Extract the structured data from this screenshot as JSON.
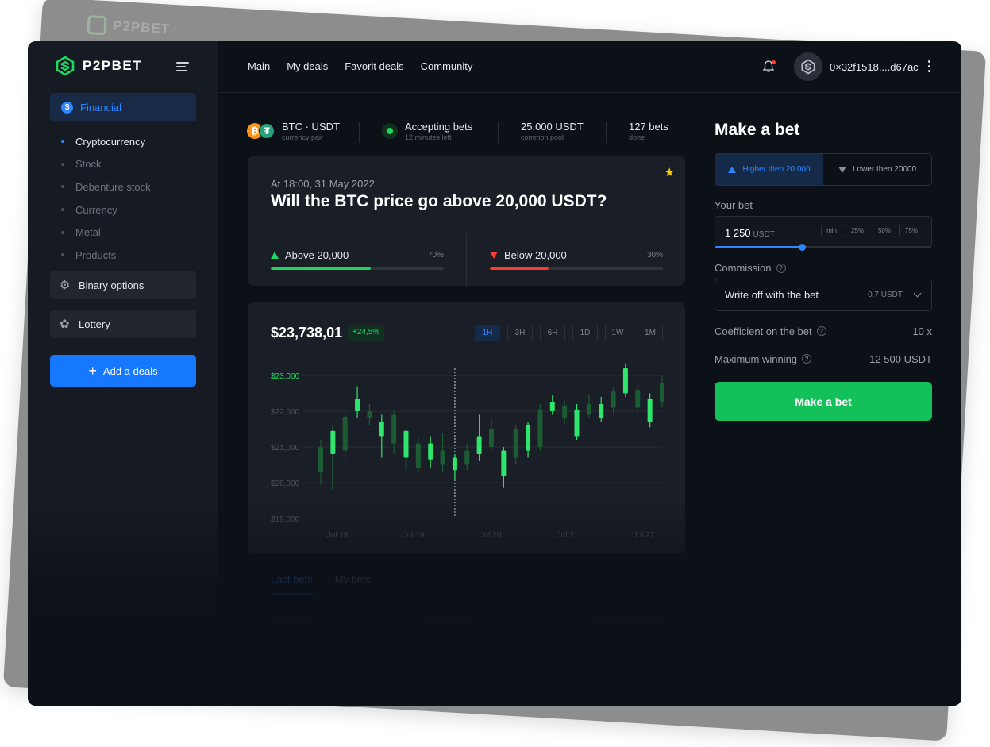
{
  "brand": {
    "name": "P2PBET",
    "accent": "#2f86ff",
    "green": "#1ed760",
    "red": "#ff3b30"
  },
  "sidebar": {
    "financial_label": "Financial",
    "sub_items": [
      "Cryptocurrency",
      "Stock",
      "Debenture stock",
      "Currency",
      "Metal",
      "Products"
    ],
    "active_sub": "Cryptocurrency",
    "binary_label": "Binary options",
    "lottery_label": "Lottery",
    "add_label": "Add a deals"
  },
  "header": {
    "nav": [
      "Main",
      "My deals",
      "Favorit deals",
      "Community"
    ],
    "wallet": "0×32f1518....d67ac"
  },
  "info": {
    "pair": "BTC · USDT",
    "pair_sub": "currency pair",
    "status": "Accepting bets",
    "status_sub": "12 minutes left",
    "pool": "25.000 USDT",
    "pool_sub": "common pool",
    "bets": "127 bets",
    "bets_sub": "done"
  },
  "question": {
    "date": "At 18:00, 31 May 2022",
    "title": "Will the BTC price go above 20,000 USDT?",
    "above_label": "Above 20,000",
    "above_pct": "70%",
    "above_value": 0.58,
    "below_label": "Below 20,000",
    "below_pct": "30%",
    "below_value": 0.34
  },
  "chart": {
    "price": "$23,738,01",
    "change": "+24,5%",
    "timeframes": [
      "1H",
      "3H",
      "6H",
      "1D",
      "1W",
      "1M"
    ],
    "active_timeframe": "1H"
  },
  "chart_data": {
    "type": "candlestick",
    "y_ticks": [
      "$23,000",
      "$22,000",
      "$21,000",
      "$20,000",
      "$19,000"
    ],
    "x_ticks": [
      "Jul 18",
      "Jul 19",
      "Jul 20",
      "Jul 21",
      "Jul 22"
    ],
    "ylim": [
      19000,
      23300
    ],
    "highlight_tick": "$23,000",
    "candles": [
      {
        "o": 20300,
        "c": 21000,
        "h": 21200,
        "l": 19950,
        "bright": false
      },
      {
        "o": 20800,
        "c": 21450,
        "h": 21600,
        "l": 19800,
        "bright": true
      },
      {
        "o": 20900,
        "c": 21850,
        "h": 22050,
        "l": 20600,
        "bright": false
      },
      {
        "o": 22000,
        "c": 22350,
        "h": 22700,
        "l": 21800,
        "bright": true
      },
      {
        "o": 22000,
        "c": 21800,
        "h": 22200,
        "l": 21600,
        "bright": false
      },
      {
        "o": 21700,
        "c": 21300,
        "h": 21900,
        "l": 20700,
        "bright": true
      },
      {
        "o": 21100,
        "c": 21900,
        "h": 22000,
        "l": 20800,
        "bright": false
      },
      {
        "o": 21450,
        "c": 20700,
        "h": 21500,
        "l": 20350,
        "bright": true
      },
      {
        "o": 21100,
        "c": 20400,
        "h": 21300,
        "l": 20300,
        "bright": false
      },
      {
        "o": 21100,
        "c": 20650,
        "h": 21300,
        "l": 20400,
        "bright": true
      },
      {
        "o": 20900,
        "c": 20500,
        "h": 21400,
        "l": 20300,
        "bright": false
      },
      {
        "o": 20350,
        "c": 20700,
        "h": 20800,
        "l": 20100,
        "bright": true
      },
      {
        "o": 20500,
        "c": 20900,
        "h": 21100,
        "l": 20350,
        "bright": false
      },
      {
        "o": 20800,
        "c": 21300,
        "h": 21900,
        "l": 20600,
        "bright": true
      },
      {
        "o": 21000,
        "c": 21500,
        "h": 21800,
        "l": 20900,
        "bright": false
      },
      {
        "o": 20200,
        "c": 20900,
        "h": 21000,
        "l": 19850,
        "bright": true
      },
      {
        "o": 20700,
        "c": 21500,
        "h": 21600,
        "l": 20500,
        "bright": false
      },
      {
        "o": 20900,
        "c": 21600,
        "h": 21700,
        "l": 20700,
        "bright": true
      },
      {
        "o": 21000,
        "c": 22050,
        "h": 22200,
        "l": 20900,
        "bright": false
      },
      {
        "o": 22250,
        "c": 22000,
        "h": 22450,
        "l": 21900,
        "bright": true
      },
      {
        "o": 22150,
        "c": 21800,
        "h": 22300,
        "l": 21650,
        "bright": false
      },
      {
        "o": 21300,
        "c": 22050,
        "h": 22200,
        "l": 21200,
        "bright": true
      },
      {
        "o": 21900,
        "c": 22200,
        "h": 22450,
        "l": 21800,
        "bright": false
      },
      {
        "o": 21800,
        "c": 22200,
        "h": 22400,
        "l": 21700,
        "bright": true
      },
      {
        "o": 22100,
        "c": 22550,
        "h": 22650,
        "l": 21900,
        "bright": false
      },
      {
        "o": 22500,
        "c": 23200,
        "h": 23350,
        "l": 22400,
        "bright": true
      },
      {
        "o": 22100,
        "c": 22600,
        "h": 22850,
        "l": 21950,
        "bright": false
      },
      {
        "o": 21700,
        "c": 22350,
        "h": 22500,
        "l": 21550,
        "bright": true
      },
      {
        "o": 22250,
        "c": 22800,
        "h": 23000,
        "l": 22100,
        "bright": false
      }
    ],
    "marker_candle": 11
  },
  "tabs": {
    "last_bets": "Last bets",
    "my_bets": "My bets",
    "active": "Last bets"
  },
  "columns": [
    "Account",
    "Ammount",
    "Date and time"
  ],
  "bet_panel": {
    "title": "Make a bet",
    "higher": "Higher then 20 000",
    "lower": "Lower then 20000",
    "your_bet_label": "Your bet",
    "bet_value": "1 250",
    "bet_unit": "USDT",
    "chips": [
      "min",
      "25%",
      "50%",
      "75%"
    ],
    "slider_value": 0.4,
    "commission_label": "Commission",
    "commission_text": "Write off with the bet",
    "commission_value": "0.7 USDT",
    "coef_label": "Coefficient on the bet",
    "coef_value": "10 x",
    "maxwin_label": "Maximum winning",
    "maxwin_value": "12 500 USDT",
    "button": "Make a bet"
  }
}
